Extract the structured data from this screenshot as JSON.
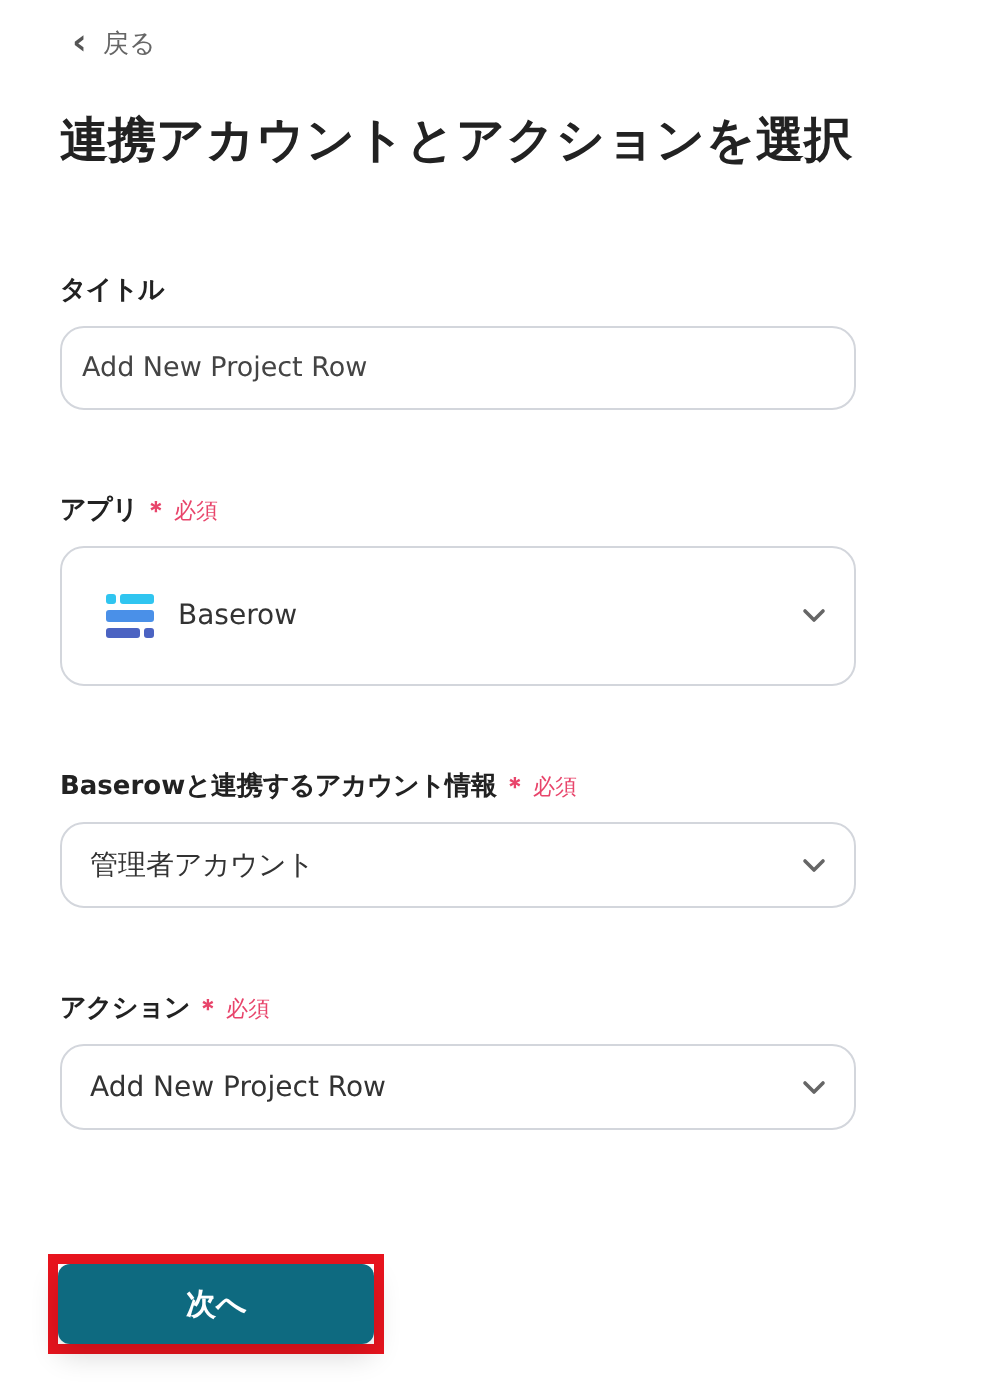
{
  "back_link": {
    "icon": "‹",
    "label": "戻る"
  },
  "title": "連携アカウントとアクションを選択",
  "fields": [
    {
      "kind": "text",
      "label": "タイトル",
      "value": "Add New Project Row"
    },
    {
      "kind": "app-select",
      "label": "アプリ",
      "required_mark": "＊",
      "required_text": "必須",
      "value": "Baserow"
    },
    {
      "kind": "select",
      "label": "Baserowと連携するアカウント情報",
      "required_mark": "＊",
      "required_text": "必須",
      "value": "管理者アカウント"
    },
    {
      "kind": "select",
      "label": "アクション",
      "required_mark": "＊",
      "required_text": "必須",
      "value": "Add New Project Row"
    }
  ],
  "next_button": {
    "label": "次へ",
    "highlighted": true
  }
}
